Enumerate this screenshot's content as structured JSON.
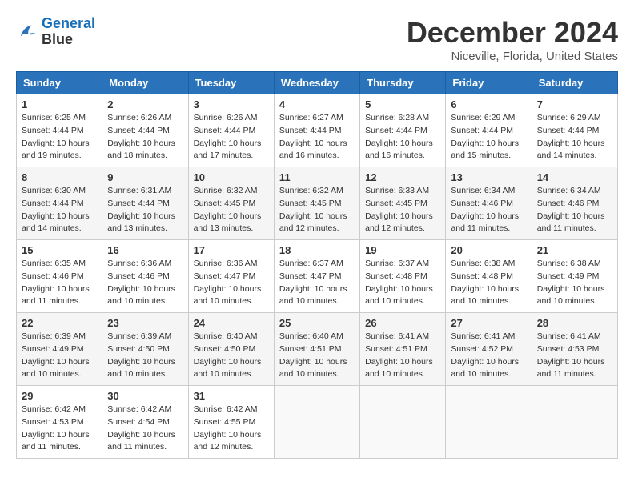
{
  "logo": {
    "line1": "General",
    "line2": "Blue"
  },
  "title": "December 2024",
  "subtitle": "Niceville, Florida, United States",
  "days_of_week": [
    "Sunday",
    "Monday",
    "Tuesday",
    "Wednesday",
    "Thursday",
    "Friday",
    "Saturday"
  ],
  "weeks": [
    [
      {
        "day": "1",
        "sunrise": "6:25 AM",
        "sunset": "4:44 PM",
        "daylight": "10 hours and 19 minutes."
      },
      {
        "day": "2",
        "sunrise": "6:26 AM",
        "sunset": "4:44 PM",
        "daylight": "10 hours and 18 minutes."
      },
      {
        "day": "3",
        "sunrise": "6:26 AM",
        "sunset": "4:44 PM",
        "daylight": "10 hours and 17 minutes."
      },
      {
        "day": "4",
        "sunrise": "6:27 AM",
        "sunset": "4:44 PM",
        "daylight": "10 hours and 16 minutes."
      },
      {
        "day": "5",
        "sunrise": "6:28 AM",
        "sunset": "4:44 PM",
        "daylight": "10 hours and 16 minutes."
      },
      {
        "day": "6",
        "sunrise": "6:29 AM",
        "sunset": "4:44 PM",
        "daylight": "10 hours and 15 minutes."
      },
      {
        "day": "7",
        "sunrise": "6:29 AM",
        "sunset": "4:44 PM",
        "daylight": "10 hours and 14 minutes."
      }
    ],
    [
      {
        "day": "8",
        "sunrise": "6:30 AM",
        "sunset": "4:44 PM",
        "daylight": "10 hours and 14 minutes."
      },
      {
        "day": "9",
        "sunrise": "6:31 AM",
        "sunset": "4:44 PM",
        "daylight": "10 hours and 13 minutes."
      },
      {
        "day": "10",
        "sunrise": "6:32 AM",
        "sunset": "4:45 PM",
        "daylight": "10 hours and 13 minutes."
      },
      {
        "day": "11",
        "sunrise": "6:32 AM",
        "sunset": "4:45 PM",
        "daylight": "10 hours and 12 minutes."
      },
      {
        "day": "12",
        "sunrise": "6:33 AM",
        "sunset": "4:45 PM",
        "daylight": "10 hours and 12 minutes."
      },
      {
        "day": "13",
        "sunrise": "6:34 AM",
        "sunset": "4:46 PM",
        "daylight": "10 hours and 11 minutes."
      },
      {
        "day": "14",
        "sunrise": "6:34 AM",
        "sunset": "4:46 PM",
        "daylight": "10 hours and 11 minutes."
      }
    ],
    [
      {
        "day": "15",
        "sunrise": "6:35 AM",
        "sunset": "4:46 PM",
        "daylight": "10 hours and 11 minutes."
      },
      {
        "day": "16",
        "sunrise": "6:36 AM",
        "sunset": "4:46 PM",
        "daylight": "10 hours and 10 minutes."
      },
      {
        "day": "17",
        "sunrise": "6:36 AM",
        "sunset": "4:47 PM",
        "daylight": "10 hours and 10 minutes."
      },
      {
        "day": "18",
        "sunrise": "6:37 AM",
        "sunset": "4:47 PM",
        "daylight": "10 hours and 10 minutes."
      },
      {
        "day": "19",
        "sunrise": "6:37 AM",
        "sunset": "4:48 PM",
        "daylight": "10 hours and 10 minutes."
      },
      {
        "day": "20",
        "sunrise": "6:38 AM",
        "sunset": "4:48 PM",
        "daylight": "10 hours and 10 minutes."
      },
      {
        "day": "21",
        "sunrise": "6:38 AM",
        "sunset": "4:49 PM",
        "daylight": "10 hours and 10 minutes."
      }
    ],
    [
      {
        "day": "22",
        "sunrise": "6:39 AM",
        "sunset": "4:49 PM",
        "daylight": "10 hours and 10 minutes."
      },
      {
        "day": "23",
        "sunrise": "6:39 AM",
        "sunset": "4:50 PM",
        "daylight": "10 hours and 10 minutes."
      },
      {
        "day": "24",
        "sunrise": "6:40 AM",
        "sunset": "4:50 PM",
        "daylight": "10 hours and 10 minutes."
      },
      {
        "day": "25",
        "sunrise": "6:40 AM",
        "sunset": "4:51 PM",
        "daylight": "10 hours and 10 minutes."
      },
      {
        "day": "26",
        "sunrise": "6:41 AM",
        "sunset": "4:51 PM",
        "daylight": "10 hours and 10 minutes."
      },
      {
        "day": "27",
        "sunrise": "6:41 AM",
        "sunset": "4:52 PM",
        "daylight": "10 hours and 10 minutes."
      },
      {
        "day": "28",
        "sunrise": "6:41 AM",
        "sunset": "4:53 PM",
        "daylight": "10 hours and 11 minutes."
      }
    ],
    [
      {
        "day": "29",
        "sunrise": "6:42 AM",
        "sunset": "4:53 PM",
        "daylight": "10 hours and 11 minutes."
      },
      {
        "day": "30",
        "sunrise": "6:42 AM",
        "sunset": "4:54 PM",
        "daylight": "10 hours and 11 minutes."
      },
      {
        "day": "31",
        "sunrise": "6:42 AM",
        "sunset": "4:55 PM",
        "daylight": "10 hours and 12 minutes."
      },
      null,
      null,
      null,
      null
    ]
  ]
}
